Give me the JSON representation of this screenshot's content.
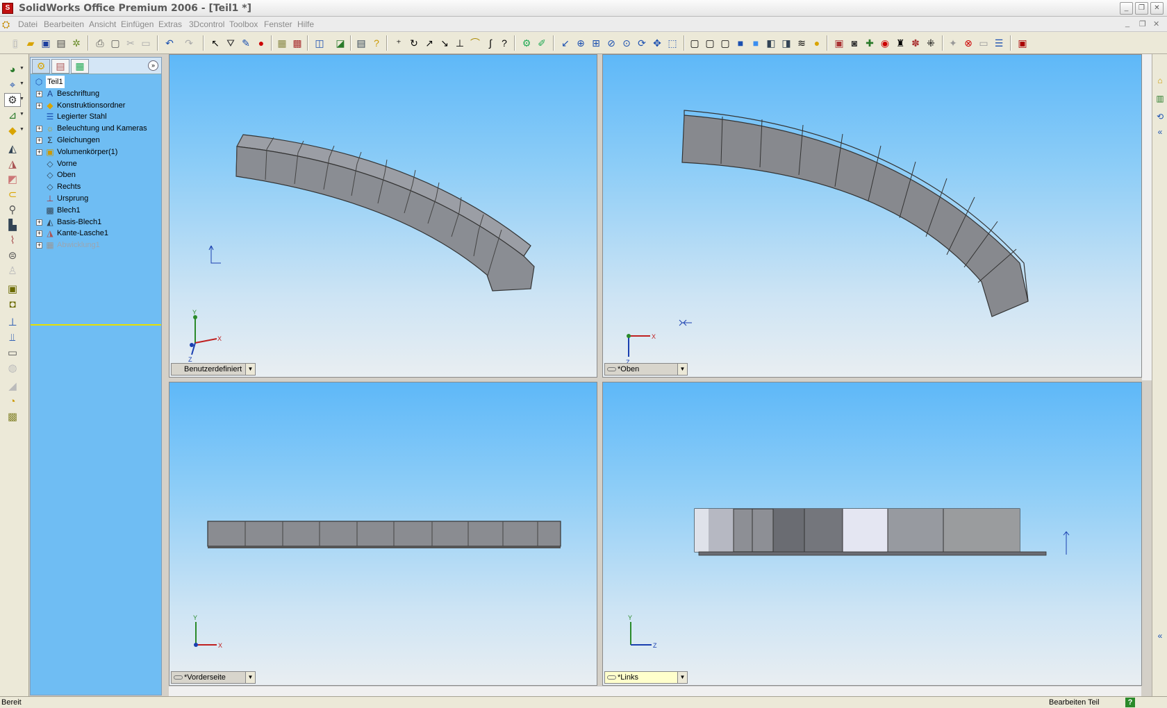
{
  "window": {
    "title": "SolidWorks Office Premium 2006 - [Teil1 *]"
  },
  "menu": [
    "Datei",
    "Bearbeiten",
    "Ansicht",
    "Einfügen",
    "Extras",
    "3Dcontrol",
    "Toolbox",
    "Fenster",
    "Hilfe"
  ],
  "tree": {
    "items": [
      {
        "label": "Teil1",
        "icon": "part-icon",
        "expand": false
      },
      {
        "label": "Beschriftung",
        "icon": "annotation-icon",
        "expand": true
      },
      {
        "label": "Konstruktionsordner",
        "icon": "design-folder-icon",
        "expand": true
      },
      {
        "label": "Legierter Stahl",
        "icon": "material-icon",
        "expand": false
      },
      {
        "label": "Beleuchtung und Kameras",
        "icon": "lights-icon",
        "expand": true
      },
      {
        "label": "Gleichungen",
        "icon": "equations-icon",
        "expand": true
      },
      {
        "label": "Volumenkörper(1)",
        "icon": "solid-bodies-icon",
        "expand": true
      },
      {
        "label": "Vorne",
        "icon": "plane-icon",
        "expand": false
      },
      {
        "label": "Oben",
        "icon": "plane-icon",
        "expand": false
      },
      {
        "label": "Rechts",
        "icon": "plane-icon",
        "expand": false
      },
      {
        "label": "Ursprung",
        "icon": "origin-icon",
        "expand": false
      },
      {
        "label": "Blech1",
        "icon": "sheet-metal-icon",
        "expand": false
      },
      {
        "label": "Basis-Blech1",
        "icon": "base-flange-icon",
        "expand": true
      },
      {
        "label": "Kante-Lasche1",
        "icon": "edge-flange-icon",
        "expand": true
      },
      {
        "label": "Abwicklung1",
        "icon": "flat-pattern-icon",
        "expand": true,
        "suppressed": true
      }
    ]
  },
  "viewports": {
    "tl": {
      "label": "Benutzerdefiniert"
    },
    "tr": {
      "label": "*Oben"
    },
    "bl": {
      "label": "*Vorderseite"
    },
    "br": {
      "label": "*Links"
    }
  },
  "axes": {
    "x": "X",
    "y": "Y",
    "z": "Z"
  },
  "status": {
    "left": "Bereit",
    "right": "Bearbeiten Teil",
    "help": "?"
  },
  "colors": {
    "viewport_top": "#5eb8f8",
    "featuremanager_bg": "#6fbdf3",
    "part_face": "#8c8e93"
  }
}
